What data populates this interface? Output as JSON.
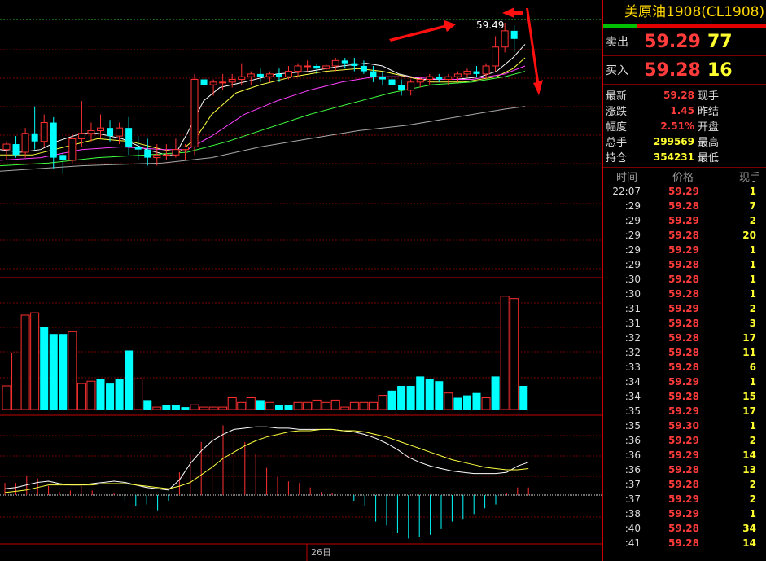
{
  "chart": {
    "price_label": "59.49",
    "date_label": "26日",
    "colors": {
      "up": "#ff3030",
      "down": "#00ffff",
      "ma5": "#ffffff",
      "ma10": "#ffff40",
      "ma20": "#ff40ff",
      "ma40": "#40ff40",
      "ma60": "#aaaaaa",
      "grid": "#7a0000",
      "arrow": "#ff1010"
    },
    "candles": [
      [
        59.02,
        59.05,
        58.98,
        59.04
      ],
      [
        59.04,
        59.07,
        58.99,
        59.0
      ],
      [
        59.01,
        59.1,
        58.99,
        59.08
      ],
      [
        59.08,
        59.18,
        59.02,
        59.05
      ],
      [
        59.05,
        59.15,
        59.03,
        59.12
      ],
      [
        59.12,
        59.14,
        58.95,
        58.99
      ],
      [
        59.0,
        59.01,
        58.93,
        58.98
      ],
      [
        58.98,
        59.08,
        58.97,
        59.06
      ],
      [
        59.06,
        59.2,
        59.03,
        59.08
      ],
      [
        59.08,
        59.12,
        59.05,
        59.09
      ],
      [
        59.09,
        59.15,
        59.06,
        59.1
      ],
      [
        59.1,
        59.13,
        59.05,
        59.07
      ],
      [
        59.07,
        59.12,
        59.04,
        59.1
      ],
      [
        59.1,
        59.14,
        59.0,
        59.03
      ],
      [
        59.03,
        59.07,
        58.98,
        59.02
      ],
      [
        59.02,
        59.06,
        58.96,
        58.99
      ],
      [
        58.99,
        59.04,
        58.96,
        59.0
      ],
      [
        59.0,
        59.04,
        58.98,
        59.0
      ],
      [
        59.0,
        59.06,
        58.99,
        59.02
      ],
      [
        59.02,
        59.04,
        58.98,
        59.03
      ],
      [
        59.03,
        59.3,
        59.0,
        59.28
      ],
      [
        59.28,
        59.3,
        59.25,
        59.26
      ],
      [
        59.26,
        59.28,
        59.22,
        59.27
      ],
      [
        59.27,
        59.3,
        59.24,
        59.27
      ],
      [
        59.27,
        59.3,
        59.25,
        59.28
      ],
      [
        59.28,
        59.34,
        59.26,
        59.29
      ],
      [
        59.29,
        59.31,
        59.26,
        59.3
      ],
      [
        59.3,
        59.32,
        59.27,
        59.29
      ],
      [
        59.29,
        59.31,
        59.27,
        59.3
      ],
      [
        59.3,
        59.32,
        59.27,
        59.29
      ],
      [
        59.29,
        59.33,
        59.28,
        59.31
      ],
      [
        59.31,
        59.34,
        59.29,
        59.33
      ],
      [
        59.33,
        59.35,
        59.31,
        59.33
      ],
      [
        59.33,
        59.34,
        59.3,
        59.32
      ],
      [
        59.32,
        59.34,
        59.3,
        59.33
      ],
      [
        59.33,
        59.36,
        59.31,
        59.35
      ],
      [
        59.35,
        59.36,
        59.32,
        59.34
      ],
      [
        59.34,
        59.36,
        59.31,
        59.33
      ],
      [
        59.33,
        59.35,
        59.3,
        59.31
      ],
      [
        59.31,
        59.33,
        59.27,
        59.29
      ],
      [
        59.29,
        59.31,
        59.26,
        59.28
      ],
      [
        59.28,
        59.3,
        59.25,
        59.26
      ],
      [
        59.26,
        59.28,
        59.22,
        59.24
      ],
      [
        59.24,
        59.28,
        59.22,
        59.27
      ],
      [
        59.27,
        59.29,
        59.25,
        59.28
      ],
      [
        59.28,
        59.3,
        59.26,
        59.29
      ],
      [
        59.29,
        59.3,
        59.27,
        59.28
      ],
      [
        59.28,
        59.3,
        59.26,
        59.29
      ],
      [
        59.29,
        59.31,
        59.27,
        59.3
      ],
      [
        59.3,
        59.32,
        59.29,
        59.31
      ],
      [
        59.31,
        59.33,
        59.29,
        59.3
      ],
      [
        59.3,
        59.34,
        59.28,
        59.33
      ],
      [
        59.33,
        59.44,
        59.31,
        59.4
      ],
      [
        59.4,
        59.49,
        59.38,
        59.46
      ],
      [
        59.46,
        59.48,
        59.38,
        59.43
      ]
    ],
    "volumes": [
      [
        10,
        1
      ],
      [
        24,
        1
      ],
      [
        40,
        1
      ],
      [
        41,
        1
      ],
      [
        35,
        0
      ],
      [
        32,
        0
      ],
      [
        32,
        0
      ],
      [
        33,
        1
      ],
      [
        11,
        1
      ],
      [
        12,
        1
      ],
      [
        13,
        0
      ],
      [
        11,
        0
      ],
      [
        13,
        0
      ],
      [
        25,
        0
      ],
      [
        13,
        1
      ],
      [
        4,
        0
      ],
      [
        1,
        1
      ],
      [
        2,
        0
      ],
      [
        2,
        0
      ],
      [
        1,
        0
      ],
      [
        2,
        1
      ],
      [
        1,
        1
      ],
      [
        1,
        1
      ],
      [
        1,
        1
      ],
      [
        5,
        1
      ],
      [
        3,
        1
      ],
      [
        5,
        1
      ],
      [
        4,
        0
      ],
      [
        3,
        1
      ],
      [
        2,
        0
      ],
      [
        2,
        0
      ],
      [
        3,
        1
      ],
      [
        3,
        1
      ],
      [
        4,
        1
      ],
      [
        3,
        1
      ],
      [
        4,
        1
      ],
      [
        1,
        1
      ],
      [
        3,
        1
      ],
      [
        3,
        1
      ],
      [
        3,
        1
      ],
      [
        6,
        1
      ],
      [
        8,
        0
      ],
      [
        10,
        0
      ],
      [
        10,
        0
      ],
      [
        14,
        0
      ],
      [
        13,
        0
      ],
      [
        12,
        0
      ],
      [
        7,
        1
      ],
      [
        5,
        0
      ],
      [
        6,
        0
      ],
      [
        7,
        0
      ],
      [
        5,
        1
      ],
      [
        14,
        0
      ],
      [
        48,
        1
      ],
      [
        47,
        1
      ],
      [
        10,
        0
      ]
    ],
    "macd": [
      [
        0.5,
        0.2,
        0.8
      ],
      [
        0.6,
        0.3,
        0.8
      ],
      [
        0.8,
        0.4,
        1.3
      ],
      [
        1.0,
        0.6,
        1.1
      ],
      [
        1.1,
        0.8,
        0.6
      ],
      [
        0.9,
        0.8,
        0.2
      ],
      [
        0.8,
        0.8,
        0.3
      ],
      [
        0.8,
        0.8,
        0.6
      ],
      [
        0.9,
        0.8,
        0.3
      ],
      [
        1.0,
        0.9,
        0.1
      ],
      [
        1.1,
        0.9,
        0.1
      ],
      [
        1.0,
        0.9,
        -0.3
      ],
      [
        0.8,
        0.8,
        -0.6
      ],
      [
        0.6,
        0.7,
        -0.5
      ],
      [
        0.5,
        0.6,
        -0.8
      ],
      [
        0.4,
        0.5,
        -0.3
      ],
      [
        1.2,
        0.7,
        1.5
      ],
      [
        2.5,
        1.0,
        2.7
      ],
      [
        3.5,
        1.6,
        3.5
      ],
      [
        4.3,
        2.2,
        4.3
      ],
      [
        4.8,
        2.9,
        4.6
      ],
      [
        5.2,
        3.4,
        4.2
      ],
      [
        5.3,
        3.9,
        3.5
      ],
      [
        5.4,
        4.3,
        2.7
      ],
      [
        5.4,
        4.6,
        1.8
      ],
      [
        5.3,
        4.8,
        1.2
      ],
      [
        5.3,
        5.0,
        0.9
      ],
      [
        5.2,
        5.1,
        0.8
      ],
      [
        5.2,
        5.1,
        0.5
      ],
      [
        5.2,
        5.2,
        0.2
      ],
      [
        5.2,
        5.2,
        0.1
      ],
      [
        5.1,
        5.1,
        0.0
      ],
      [
        5.0,
        5.1,
        -0.3
      ],
      [
        4.8,
        5.0,
        -0.6
      ],
      [
        4.5,
        4.8,
        -1.4
      ],
      [
        4.1,
        4.6,
        -1.6
      ],
      [
        3.6,
        4.3,
        -2.0
      ],
      [
        3.0,
        4.0,
        -2.3
      ],
      [
        2.6,
        3.7,
        -2.2
      ],
      [
        2.3,
        3.4,
        -2.1
      ],
      [
        2.1,
        3.1,
        -1.8
      ],
      [
        1.9,
        2.8,
        -1.4
      ],
      [
        1.8,
        2.6,
        -1.3
      ],
      [
        1.7,
        2.4,
        -1.0
      ],
      [
        1.7,
        2.2,
        -0.7
      ],
      [
        1.7,
        2.1,
        -0.5
      ],
      [
        1.8,
        2.0,
        0.1
      ],
      [
        2.3,
        2.0,
        0.5
      ],
      [
        2.6,
        2.1,
        0.5
      ]
    ],
    "ma_series": {
      "ma5": [
        [
          0,
          59.02
        ],
        [
          25,
          59.01
        ],
        [
          50,
          59.02
        ],
        [
          70,
          59.05
        ],
        [
          100,
          59.08
        ],
        [
          120,
          59.08
        ],
        [
          150,
          59.06
        ],
        [
          180,
          59.02
        ],
        [
          205,
          59.0
        ],
        [
          215,
          59.0
        ],
        [
          230,
          59.08
        ],
        [
          250,
          59.2
        ],
        [
          270,
          59.25
        ],
        [
          300,
          59.27
        ],
        [
          340,
          59.3
        ],
        [
          380,
          59.31
        ],
        [
          420,
          59.33
        ],
        [
          450,
          59.34
        ],
        [
          470,
          59.33
        ],
        [
          490,
          59.3
        ],
        [
          520,
          59.28
        ],
        [
          560,
          59.28
        ],
        [
          590,
          59.29
        ],
        [
          610,
          59.31
        ],
        [
          630,
          59.36
        ],
        [
          645,
          59.41
        ]
      ],
      "ma10": [
        [
          0,
          59.0
        ],
        [
          40,
          59.0
        ],
        [
          80,
          59.03
        ],
        [
          120,
          59.06
        ],
        [
          160,
          59.05
        ],
        [
          200,
          59.02
        ],
        [
          220,
          59.01
        ],
        [
          240,
          59.06
        ],
        [
          260,
          59.15
        ],
        [
          290,
          59.23
        ],
        [
          320,
          59.26
        ],
        [
          360,
          59.29
        ],
        [
          400,
          59.31
        ],
        [
          440,
          59.32
        ],
        [
          470,
          59.31
        ],
        [
          500,
          59.29
        ],
        [
          530,
          59.27
        ],
        [
          570,
          59.27
        ],
        [
          610,
          59.29
        ],
        [
          630,
          59.32
        ],
        [
          645,
          59.36
        ]
      ],
      "ma20": [
        [
          0,
          58.98
        ],
        [
          50,
          58.99
        ],
        [
          100,
          59.02
        ],
        [
          150,
          59.03
        ],
        [
          200,
          59.02
        ],
        [
          230,
          59.02
        ],
        [
          260,
          59.07
        ],
        [
          300,
          59.15
        ],
        [
          340,
          59.2
        ],
        [
          380,
          59.24
        ],
        [
          420,
          59.27
        ],
        [
          460,
          59.29
        ],
        [
          500,
          59.29
        ],
        [
          540,
          59.28
        ],
        [
          580,
          59.28
        ],
        [
          620,
          59.3
        ],
        [
          645,
          59.33
        ]
      ],
      "ma40": [
        [
          0,
          58.96
        ],
        [
          60,
          58.97
        ],
        [
          120,
          58.99
        ],
        [
          180,
          59.0
        ],
        [
          230,
          59.01
        ],
        [
          280,
          59.05
        ],
        [
          330,
          59.1
        ],
        [
          380,
          59.15
        ],
        [
          430,
          59.19
        ],
        [
          480,
          59.23
        ],
        [
          530,
          59.26
        ],
        [
          580,
          59.27
        ],
        [
          620,
          59.29
        ],
        [
          645,
          59.31
        ]
      ],
      "ma60": [
        [
          0,
          58.94
        ],
        [
          100,
          58.96
        ],
        [
          200,
          58.97
        ],
        [
          260,
          58.99
        ],
        [
          320,
          59.03
        ],
        [
          380,
          59.06
        ],
        [
          440,
          59.09
        ],
        [
          500,
          59.11
        ],
        [
          560,
          59.14
        ],
        [
          620,
          59.17
        ],
        [
          645,
          59.18
        ]
      ]
    }
  },
  "panel": {
    "title": "美原油1908(CL1908)",
    "ask": {
      "label": "卖出",
      "price": "59.29",
      "vol": "77"
    },
    "bid": {
      "label": "买入",
      "price": "59.28",
      "vol": "16"
    },
    "stats": [
      {
        "label": "最新",
        "value": "59.28",
        "suffix": "现手",
        "color": "red"
      },
      {
        "label": "涨跌",
        "value": "1.45",
        "suffix": "昨结",
        "color": "red"
      },
      {
        "label": "幅度",
        "value": "2.51%",
        "suffix": "开盘",
        "color": "red"
      },
      {
        "label": "总手",
        "value": "299569",
        "suffix": "最高",
        "color": "yel"
      },
      {
        "label": "持仓",
        "value": "354231",
        "suffix": "最低",
        "color": "yel"
      }
    ],
    "table_header": {
      "time": "时间",
      "price": "价格",
      "vol": "现手"
    },
    "ticks": [
      [
        "22:07",
        "59.29",
        "1"
      ],
      [
        ":29",
        "59.28",
        "7"
      ],
      [
        ":29",
        "59.29",
        "2"
      ],
      [
        ":29",
        "59.28",
        "20"
      ],
      [
        ":29",
        "59.29",
        "1"
      ],
      [
        ":29",
        "59.28",
        "1"
      ],
      [
        ":30",
        "59.28",
        "1"
      ],
      [
        ":30",
        "59.28",
        "1"
      ],
      [
        ":31",
        "59.29",
        "2"
      ],
      [
        ":31",
        "59.28",
        "3"
      ],
      [
        ":32",
        "59.28",
        "17"
      ],
      [
        ":32",
        "59.28",
        "11"
      ],
      [
        ":33",
        "59.28",
        "6"
      ],
      [
        ":34",
        "59.29",
        "1"
      ],
      [
        ":34",
        "59.28",
        "15"
      ],
      [
        ":35",
        "59.29",
        "17"
      ],
      [
        ":35",
        "59.30",
        "1"
      ],
      [
        ":36",
        "59.29",
        "2"
      ],
      [
        ":36",
        "59.29",
        "14"
      ],
      [
        ":36",
        "59.28",
        "13"
      ],
      [
        ":37",
        "59.28",
        "2"
      ],
      [
        ":37",
        "59.29",
        "2"
      ],
      [
        ":38",
        "59.29",
        "1"
      ],
      [
        ":40",
        "59.28",
        "34"
      ],
      [
        ":41",
        "59.28",
        "14"
      ]
    ]
  }
}
